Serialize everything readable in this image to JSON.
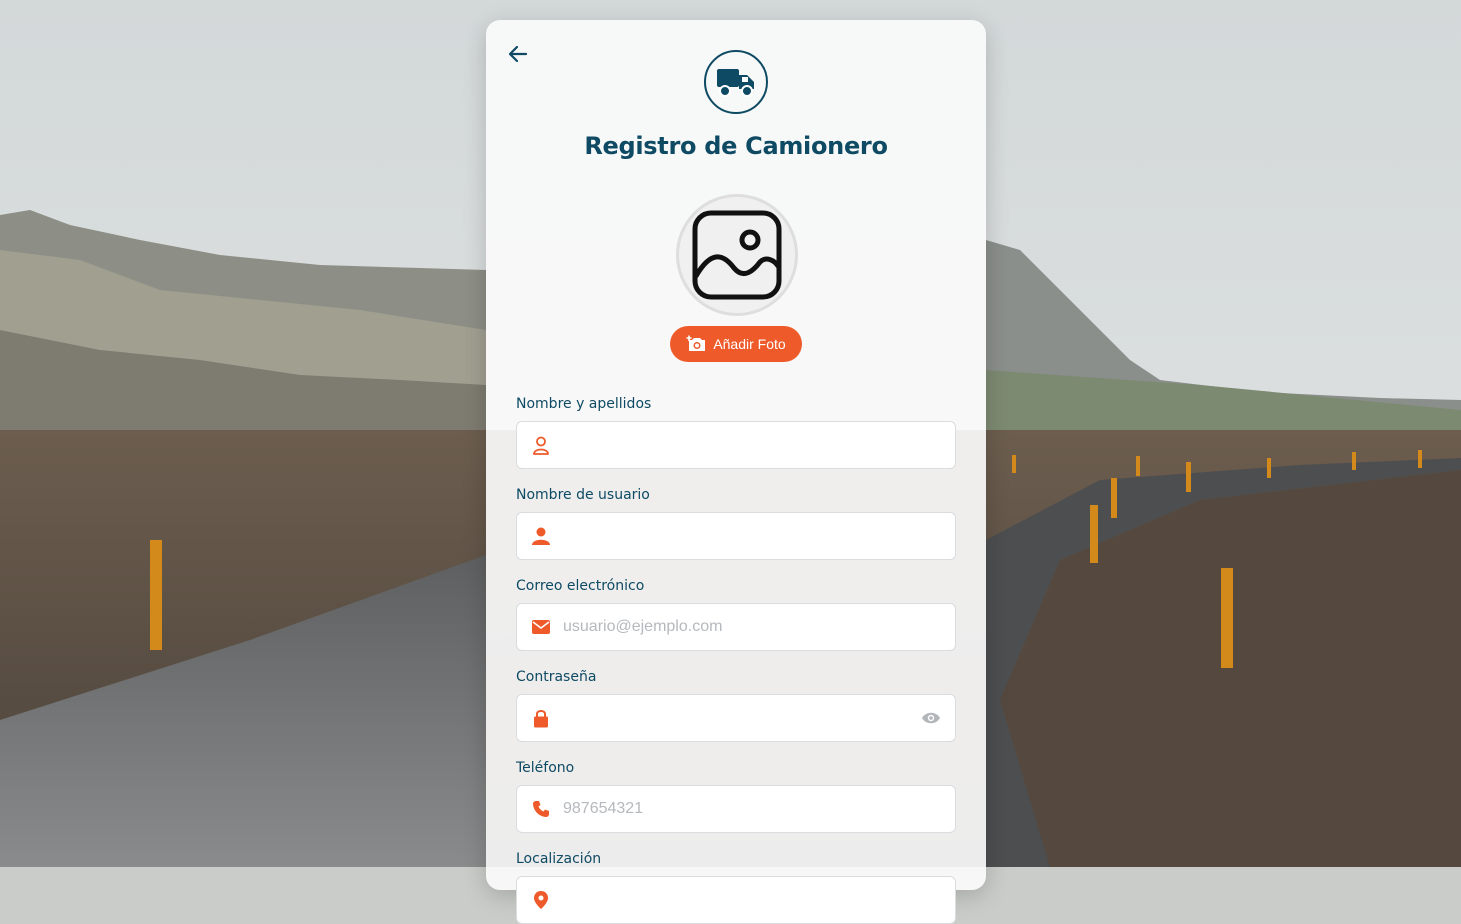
{
  "page": {
    "title": "Registro de Camionero",
    "add_photo_label": "Añadir Foto"
  },
  "icons": {
    "back": "arrow-left-icon",
    "logo": "truck-icon",
    "avatar": "image-placeholder-icon",
    "add_photo": "camera-plus-icon"
  },
  "colors": {
    "primary": "#0e4a63",
    "accent": "#ee5a2a"
  },
  "form": {
    "fields": [
      {
        "label": "Nombre y apellidos",
        "placeholder": "",
        "value": "",
        "icon": "user-outline-icon"
      },
      {
        "label": "Nombre de usuario",
        "placeholder": "",
        "value": "",
        "icon": "user-filled-icon"
      },
      {
        "label": "Correo electrónico",
        "placeholder": "usuario@ejemplo.com",
        "value": "",
        "icon": "mail-icon"
      },
      {
        "label": "Contraseña",
        "placeholder": "",
        "value": "",
        "icon": "lock-icon"
      },
      {
        "label": "Teléfono",
        "placeholder": "987654321",
        "value": "",
        "icon": "phone-icon"
      },
      {
        "label": "Localización",
        "placeholder": "",
        "value": "",
        "icon": "location-icon"
      }
    ]
  }
}
